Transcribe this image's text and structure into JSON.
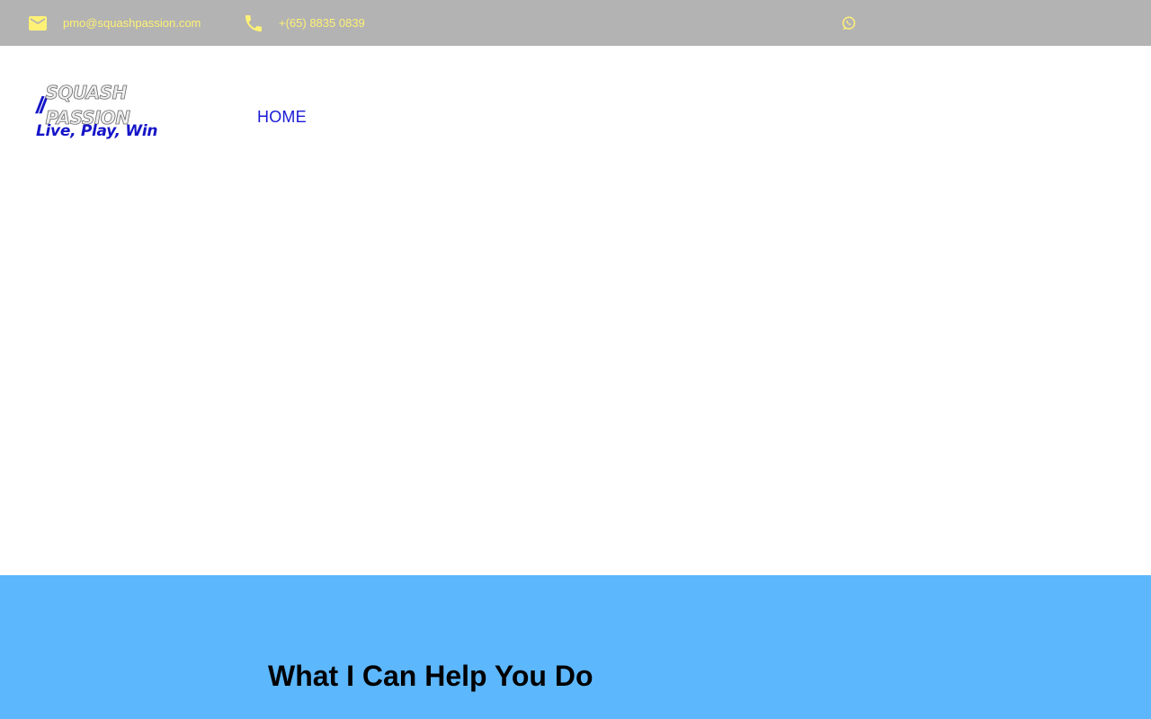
{
  "topbar": {
    "email": "pmo@squashpassion.com",
    "phone": "+(65) 8835 0839",
    "icons": {
      "email": "mail-icon",
      "phone": "phone-icon",
      "whatsapp": "whatsapp-icon"
    },
    "text_color": "#fff176",
    "background": "#b3b3b3"
  },
  "logo": {
    "slashes": "//",
    "brand": "SQUASH PASSION",
    "tagline": "Live, Play, Win",
    "accent": "#1515c8"
  },
  "nav": {
    "home_label": "HOME"
  },
  "help_section": {
    "title": "What I Can Help You Do",
    "background": "#5cb7fd"
  }
}
